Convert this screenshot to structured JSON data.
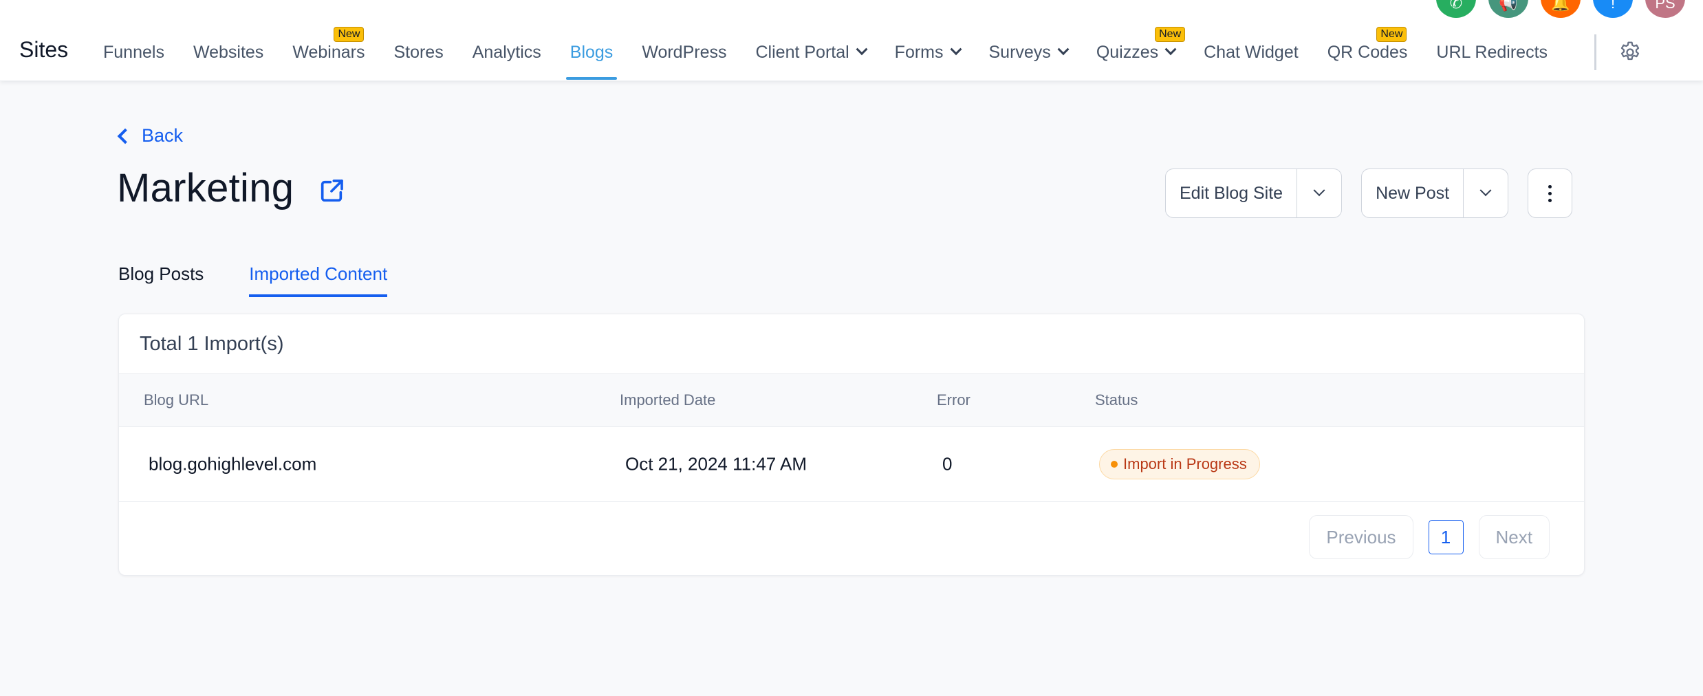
{
  "header": {
    "brand": "Sites",
    "nav": [
      {
        "label": "Funnels",
        "dropdown": false,
        "badge": null,
        "active": false
      },
      {
        "label": "Websites",
        "dropdown": false,
        "badge": null,
        "active": false
      },
      {
        "label": "Webinars",
        "dropdown": false,
        "badge": "New",
        "active": false
      },
      {
        "label": "Stores",
        "dropdown": false,
        "badge": null,
        "active": false
      },
      {
        "label": "Analytics",
        "dropdown": false,
        "badge": null,
        "active": false
      },
      {
        "label": "Blogs",
        "dropdown": false,
        "badge": null,
        "active": true
      },
      {
        "label": "WordPress",
        "dropdown": false,
        "badge": null,
        "active": false
      },
      {
        "label": "Client Portal",
        "dropdown": true,
        "badge": null,
        "active": false
      },
      {
        "label": "Forms",
        "dropdown": true,
        "badge": null,
        "active": false
      },
      {
        "label": "Surveys",
        "dropdown": true,
        "badge": null,
        "active": false
      },
      {
        "label": "Quizzes",
        "dropdown": true,
        "badge": "New",
        "active": false
      },
      {
        "label": "Chat Widget",
        "dropdown": false,
        "badge": null,
        "active": false
      },
      {
        "label": "QR Codes",
        "dropdown": false,
        "badge": "New",
        "active": false
      },
      {
        "label": "URL Redirects",
        "dropdown": false,
        "badge": null,
        "active": false
      }
    ],
    "settings_icon": "gear-icon",
    "circle_icons": [
      {
        "name": "phone-icon",
        "color": "#27ae60",
        "glyph": "✆"
      },
      {
        "name": "megaphone-icon",
        "color": "#46967d",
        "glyph": "📢"
      },
      {
        "name": "bell-icon",
        "color": "#ff6600",
        "glyph": "🔔"
      },
      {
        "name": "help-icon",
        "color": "#188bf6",
        "glyph": "!"
      },
      {
        "name": "avatar",
        "color": "#c07585",
        "glyph": "PS"
      }
    ]
  },
  "page": {
    "back_label": "Back",
    "title": "Marketing",
    "actions": {
      "edit_blog_site": "Edit Blog Site",
      "new_post": "New Post"
    },
    "tabs": [
      {
        "label": "Blog Posts",
        "active": false
      },
      {
        "label": "Imported Content",
        "active": true
      }
    ]
  },
  "imports": {
    "total_label": "Total 1 Import(s)",
    "columns": [
      "Blog URL",
      "Imported Date",
      "Error",
      "Status"
    ],
    "rows": [
      {
        "blog_url": "blog.gohighlevel.com",
        "imported_date": "Oct 21, 2024 11:47 AM",
        "error": "0",
        "status": "Import in Progress"
      }
    ],
    "pagination": {
      "previous": "Previous",
      "current_page": "1",
      "next": "Next"
    }
  },
  "colors": {
    "accent": "#155eef",
    "nav_active": "#3b9ce0",
    "badge_new": "#fbbf09",
    "status_progress": "#f79009"
  }
}
